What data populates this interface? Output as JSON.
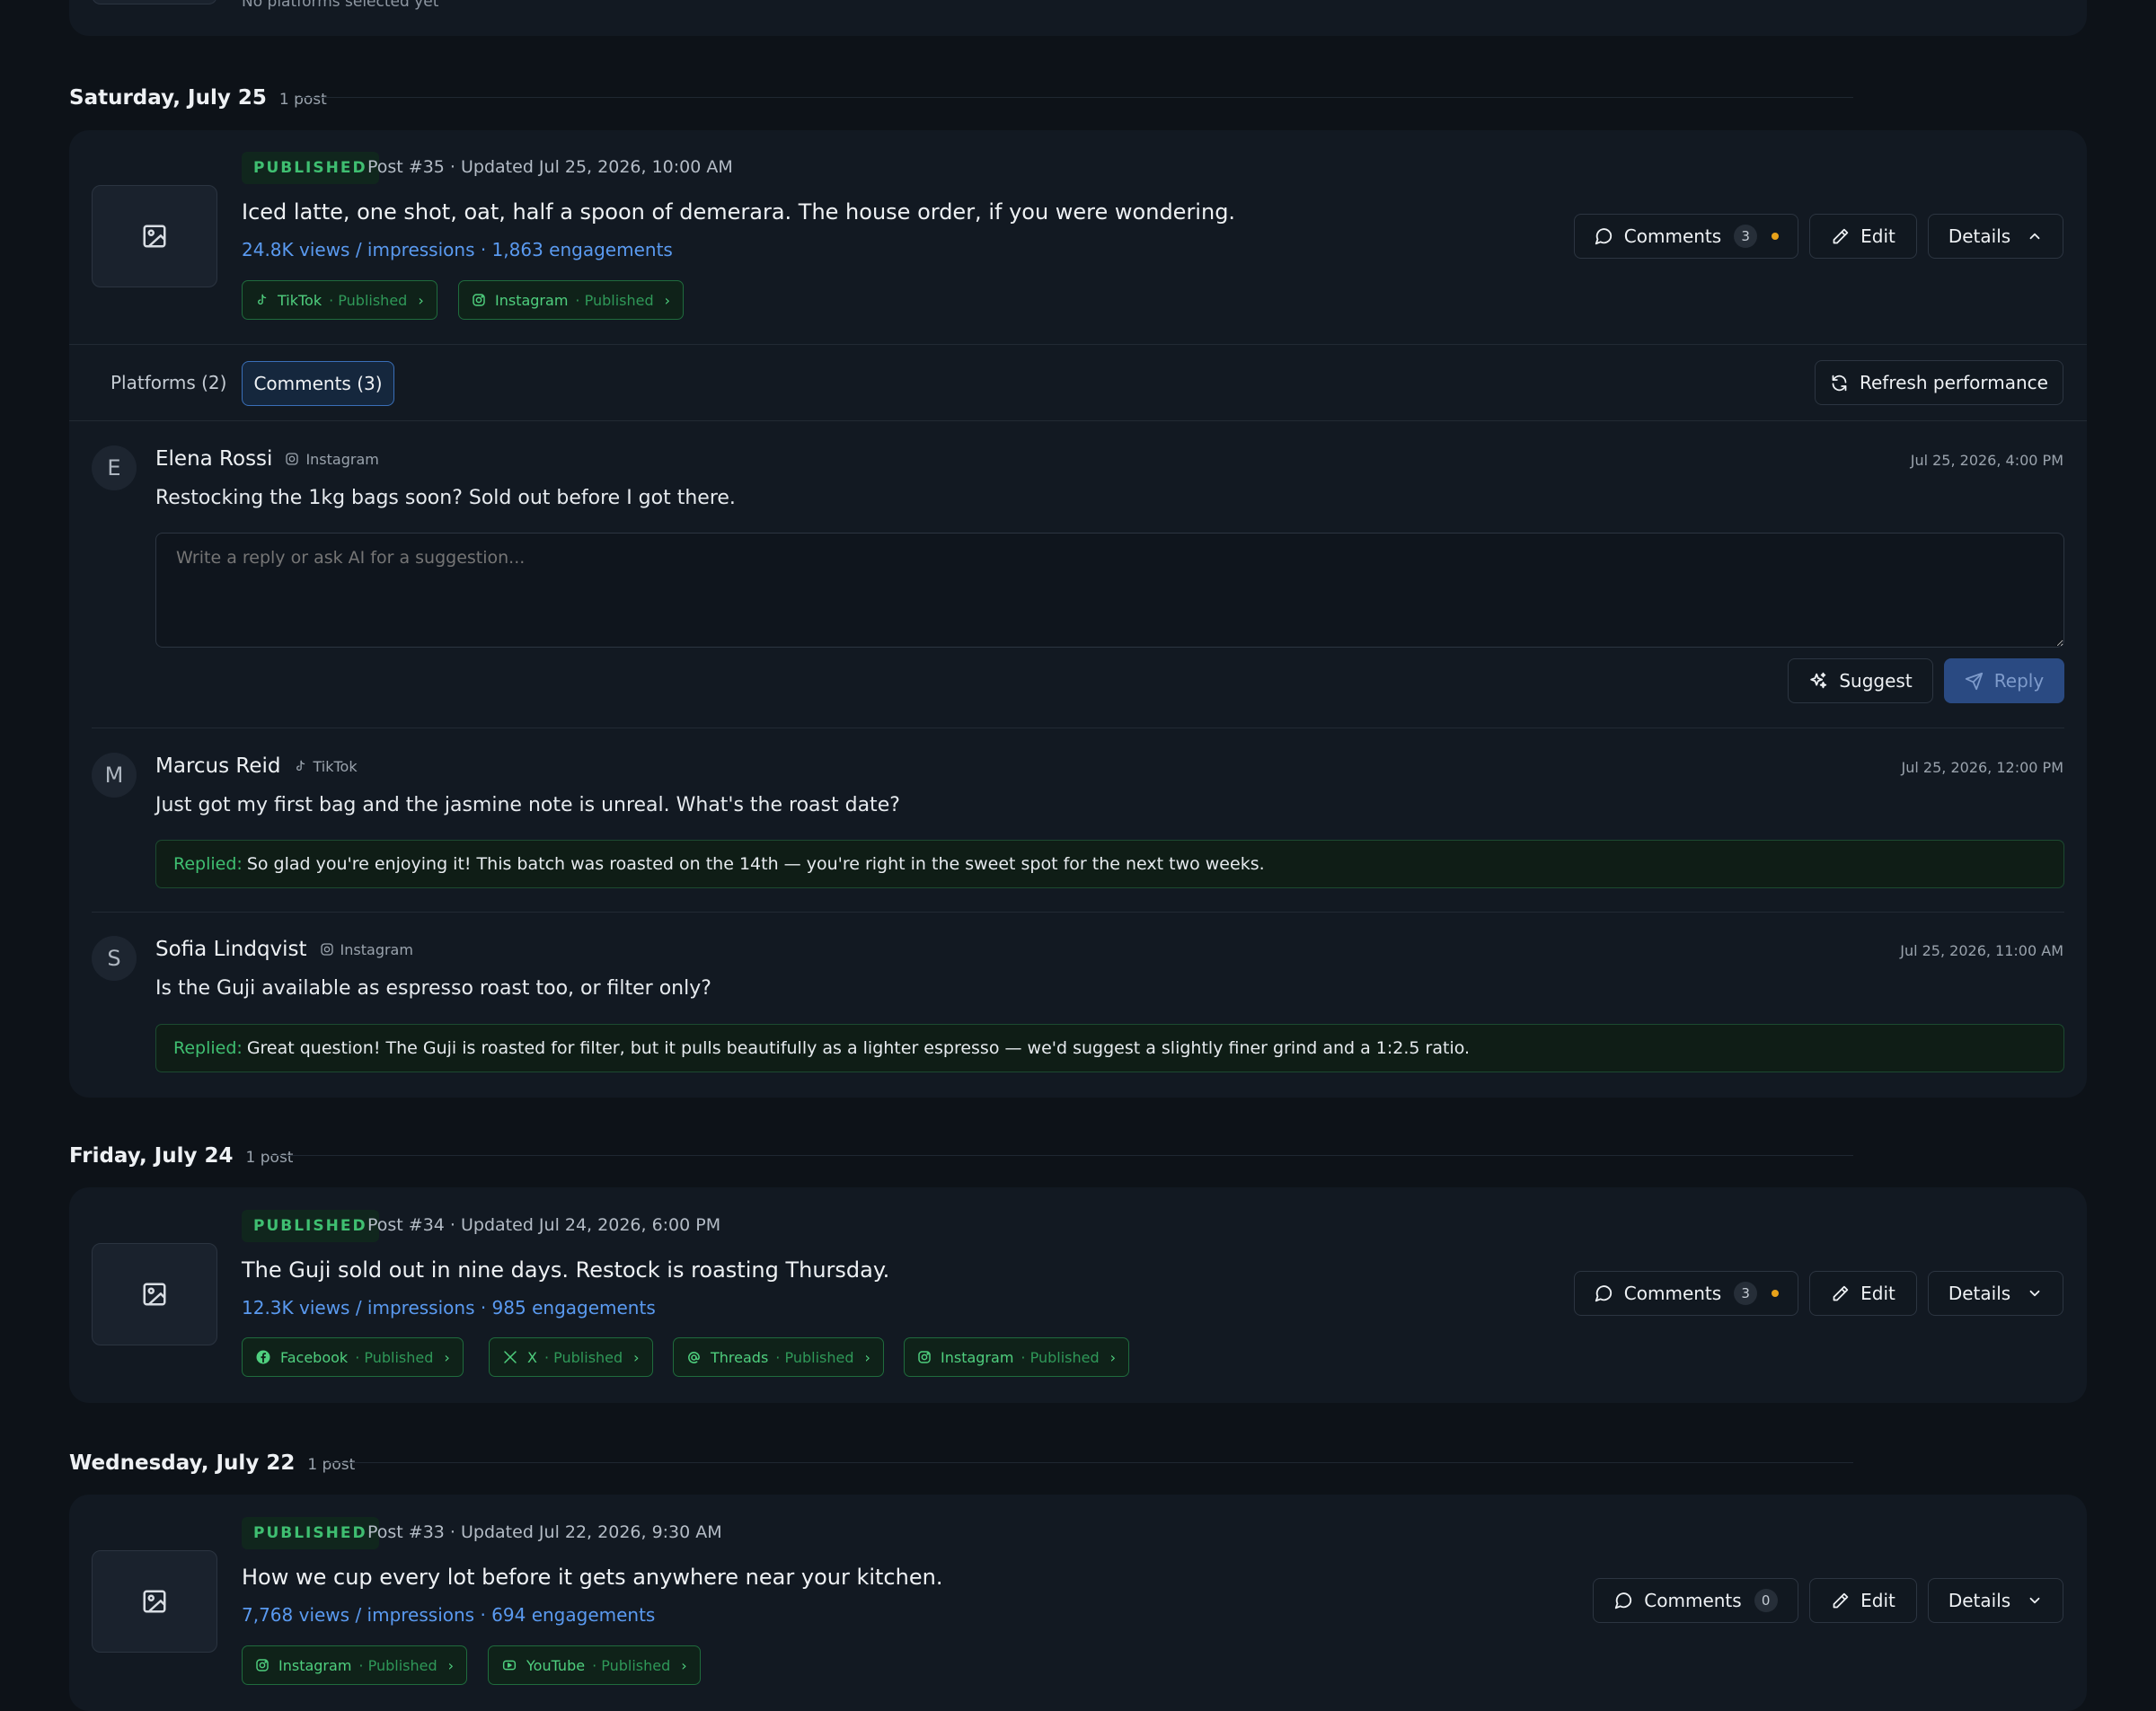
{
  "top": {
    "no_platforms": "No platforms selected yet"
  },
  "days": [
    {
      "title": "Saturday, July 25",
      "count": "1 post"
    },
    {
      "title": "Friday, July 24",
      "count": "1 post"
    },
    {
      "title": "Wednesday, July 22",
      "count": "1 post"
    }
  ],
  "posts": [
    {
      "status": "PUBLISHED",
      "meta": "Post #35 · Updated Jul 25, 2026, 10:00 AM",
      "text": "Iced latte, one shot, oat, half a spoon of demerara. The house order, if you were wondering.",
      "stats": "24.8K views / impressions · 1,863 engagements",
      "platforms": [
        {
          "name": "TikTok",
          "status": "· Published",
          "icon": "tiktok-icon"
        },
        {
          "name": "Instagram",
          "status": "· Published",
          "icon": "instagram-icon"
        }
      ],
      "comments_label": "Comments",
      "comments_count": "3",
      "edit_label": "Edit",
      "details_label": "Details"
    },
    {
      "status": "PUBLISHED",
      "meta": "Post #34 · Updated Jul 24, 2026, 6:00 PM",
      "text": "The Guji sold out in nine days. Restock is roasting Thursday.",
      "stats": "12.3K views / impressions · 985 engagements",
      "platforms": [
        {
          "name": "Facebook",
          "status": "· Published",
          "icon": "facebook-icon"
        },
        {
          "name": "X",
          "status": "· Published",
          "icon": "x-icon"
        },
        {
          "name": "Threads",
          "status": "· Published",
          "icon": "threads-icon"
        },
        {
          "name": "Instagram",
          "status": "· Published",
          "icon": "instagram-icon"
        }
      ],
      "comments_label": "Comments",
      "comments_count": "3",
      "edit_label": "Edit",
      "details_label": "Details"
    },
    {
      "status": "PUBLISHED",
      "meta": "Post #33 · Updated Jul 22, 2026, 9:30 AM",
      "text": "How we cup every lot before it gets anywhere near your kitchen.",
      "stats": "7,768 views / impressions · 694 engagements",
      "platforms": [
        {
          "name": "Instagram",
          "status": "· Published",
          "icon": "instagram-icon"
        },
        {
          "name": "YouTube",
          "status": "· Published",
          "icon": "youtube-icon"
        }
      ],
      "comments_label": "Comments",
      "comments_count": "0",
      "edit_label": "Edit",
      "details_label": "Details"
    }
  ],
  "expanded": {
    "tabs": [
      {
        "label": "Platforms (2)",
        "active": false
      },
      {
        "label": "Comments (3)",
        "active": true
      }
    ],
    "refresh_label": "Refresh performance",
    "comments": [
      {
        "initial": "E",
        "name": "Elena Rossi",
        "platform": "Instagram",
        "time": "Jul 25, 2026, 4:00 PM",
        "text": "Restocking the 1kg bags soon? Sold out before I got there."
      },
      {
        "initial": "M",
        "name": "Marcus Reid",
        "platform": "TikTok",
        "time": "Jul 25, 2026, 12:00 PM",
        "text": "Just got my first bag and the jasmine note is unreal. What's the roast date?",
        "reply_label": "Replied:",
        "reply": "So glad you're enjoying it! This batch was roasted on the 14th — you're right in the sweet spot for the next two weeks."
      },
      {
        "initial": "S",
        "name": "Sofia Lindqvist",
        "platform": "Instagram",
        "time": "Jul 25, 2026, 11:00 AM",
        "text": "Is the Guji available as espresso roast too, or filter only?",
        "reply_label": "Replied:",
        "reply": "Great question! The Guji is roasted for filter, but it pulls beautifully as a lighter espresso — we'd suggest a slightly finer grind and a 1:2.5 ratio."
      }
    ],
    "reply_placeholder": "Write a reply or ask AI for a suggestion...",
    "suggest_label": "Suggest",
    "reply_label": "Reply"
  },
  "colors": {
    "background": "#0d1218",
    "card": "#121922",
    "published_green": "#3fbf71",
    "link_blue": "#5a9af0",
    "unread_dot": "#e8a21a",
    "reply_button": "#2a4a82"
  }
}
